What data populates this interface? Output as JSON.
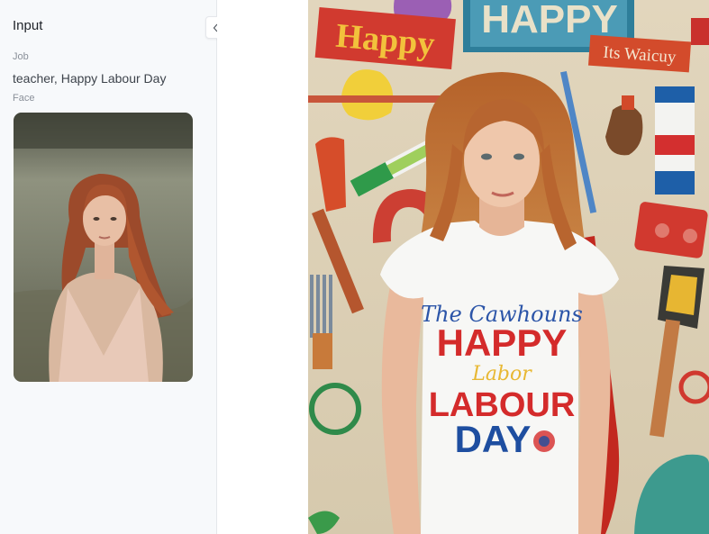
{
  "panel": {
    "title": "Input",
    "collapse_icon": "double-chevron-left-icon",
    "job_label": "Job",
    "job_value": "teacher, Happy Labour Day",
    "face_label": "Face"
  },
  "result_image": {
    "sign_happy_top": "HAPPY",
    "sign_happy_left": "Happy",
    "sign_small": "Its Waicuy",
    "shirt": {
      "line1": "The Cawhouns",
      "line2": "HAPPY",
      "line3": "Labor",
      "line4": "LABOUR",
      "line5": "DAY"
    }
  }
}
